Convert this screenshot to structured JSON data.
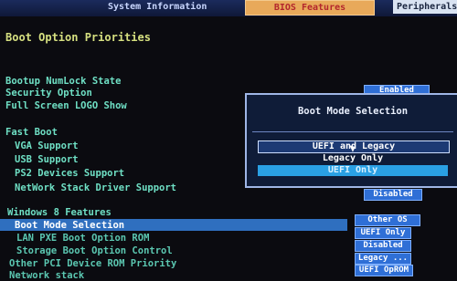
{
  "tabs": {
    "left": "System Information",
    "active": "BIOS Features",
    "right": "Peripherals"
  },
  "main": {
    "section_title": "Boot Option Priorities",
    "items": [
      {
        "label": "Bootup NumLock State",
        "value": "Enabled"
      },
      {
        "label": "Security Option",
        "value": ""
      },
      {
        "label": "Full Screen LOGO Show",
        "value": ""
      },
      {
        "label": "Fast Boot",
        "value": ""
      },
      {
        "label": "VGA Support",
        "value": ""
      },
      {
        "label": "USB Support",
        "value": ""
      },
      {
        "label": "PS2 Devices Support",
        "value": ""
      },
      {
        "label": "NetWork Stack Driver Support",
        "value": "Disabled"
      },
      {
        "label": "Windows 8 Features",
        "value": ""
      },
      {
        "label": "Boot Mode Selection",
        "value": "Other OS"
      },
      {
        "label": "LAN PXE Boot Option ROM",
        "value": "UEFI Only"
      },
      {
        "label": "Storage Boot Option Control",
        "value": "Disabled"
      },
      {
        "label": "Other PCI Device ROM Priority",
        "value": "Legacy ..."
      },
      {
        "label": "Network stack",
        "value": "UEFI OpROM"
      }
    ]
  },
  "popup": {
    "title": "Boot Mode Selection",
    "options": [
      "UEFI and Legacy",
      "Legacy Only",
      "UEFI Only"
    ],
    "focused_index": 0,
    "current_index": 2
  },
  "colors": {
    "label": "#6fe0c5",
    "title": "#d6e080",
    "value_bg": "#2f6fd6",
    "selection_bar": "#2f6fbf",
    "popup_bg": "#0f1c38"
  }
}
